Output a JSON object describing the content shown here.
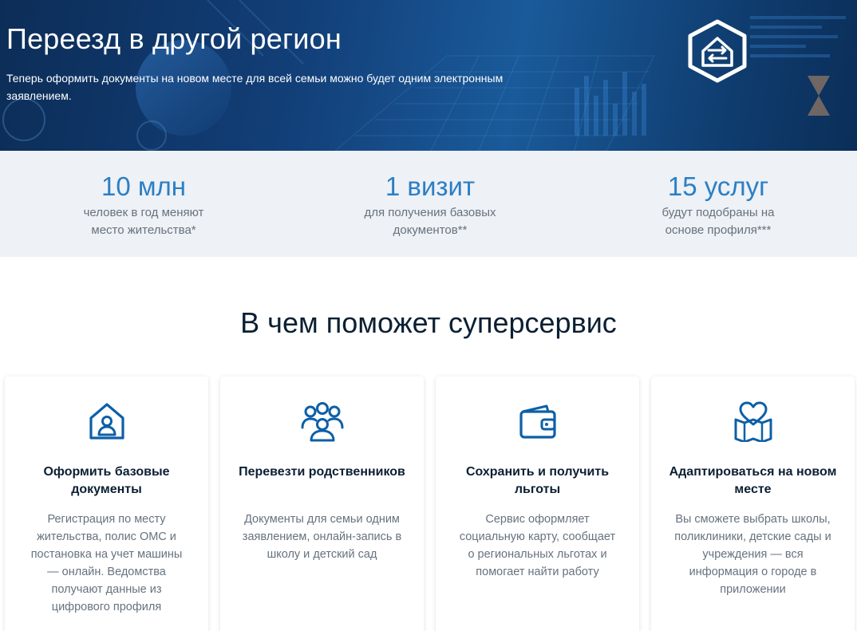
{
  "hero": {
    "title": "Переезд в другой регион",
    "subtitle": "Теперь оформить документы на новом месте для всей семьи можно будет одним электронным заявлением.",
    "icon": "house-exchange-icon"
  },
  "stats": [
    {
      "value": "10 млн",
      "desc": "человек в год меняют место жительства*"
    },
    {
      "value": "1 визит",
      "desc": "для получения базовых документов**"
    },
    {
      "value": "15 услуг",
      "desc": "будут подобраны на основе профиля***"
    }
  ],
  "section": {
    "title": "В чем поможет суперсервис",
    "cards": [
      {
        "icon": "house-user-icon",
        "title": "Оформить базовые документы",
        "text": "Регистрация по месту жительства, полис ОМС и постановка на учет машины — онлайн. Ведомства получают данные из цифрового профиля"
      },
      {
        "icon": "family-group-icon",
        "title": "Перевезти родственников",
        "text": "Документы для семьи одним заявлением, онлайн-запись в школу и детский сад"
      },
      {
        "icon": "wallet-icon",
        "title": "Сохранить и получить льготы",
        "text": "Сервис оформляет социальную карту, сообщает о региональных льготах и помогает найти работу"
      },
      {
        "icon": "heart-map-icon",
        "title": "Адаптироваться на новом месте",
        "text": "Вы сможете выбрать школы, поликлиники, детские сады и учреждения — вся информация о городе в приложении"
      }
    ]
  },
  "colors": {
    "accent": "#2b7fc5",
    "icon": "#0d5fa8",
    "stats_bg": "#eef1f5"
  }
}
